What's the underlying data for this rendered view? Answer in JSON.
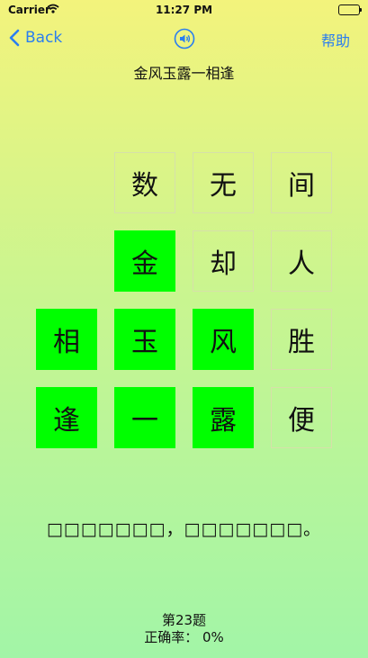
{
  "status_bar": {
    "carrier": "Carrier",
    "time": "11:27 PM"
  },
  "nav": {
    "back_label": "Back",
    "help_label": "帮助"
  },
  "title": "金风玉露一相逢",
  "grid": [
    [
      "",
      "数",
      "无",
      "间"
    ],
    [
      "",
      "金",
      "却",
      "人"
    ],
    [
      "相",
      "玉",
      "风",
      "胜"
    ],
    [
      "逢",
      "一",
      "露",
      "便"
    ]
  ],
  "selected": [
    [
      1,
      1
    ],
    [
      2,
      0
    ],
    [
      2,
      1
    ],
    [
      2,
      2
    ],
    [
      3,
      0
    ],
    [
      3,
      1
    ],
    [
      3,
      2
    ]
  ],
  "hint": "□□□□□□□，□□□□□□□。",
  "footer": {
    "question": "第23题",
    "accuracy": "正确率： 0%"
  },
  "colors": {
    "accent": "#2a7ef0",
    "selected": "#00ff00"
  }
}
